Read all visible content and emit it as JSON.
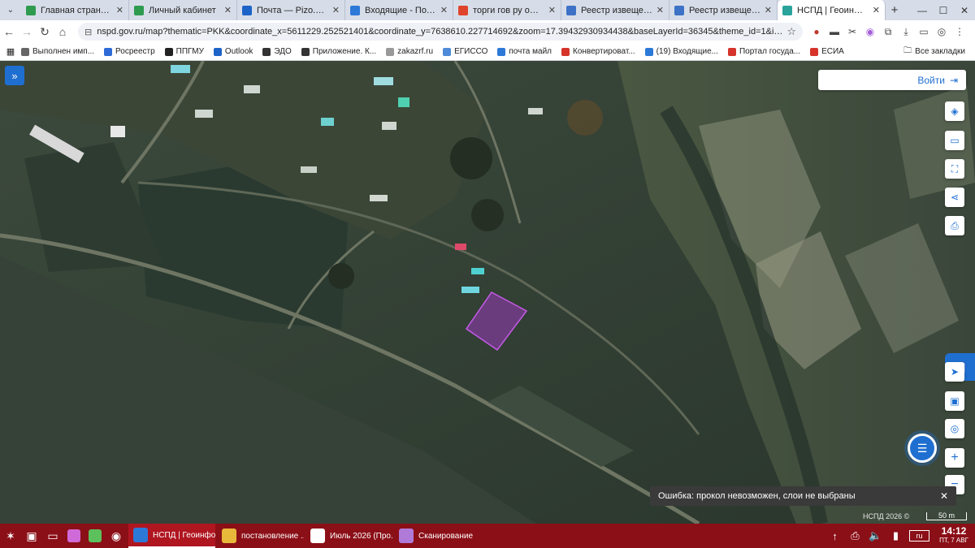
{
  "tabs": [
    {
      "title": "Главная страница",
      "color": "#2e9b4f",
      "active": false
    },
    {
      "title": "Личный кабинет",
      "color": "#2e9b4f",
      "active": false
    },
    {
      "title": "Почта — Pizo.Baltasi@",
      "color": "#1e64c8",
      "active": false
    },
    {
      "title": "Входящие - Почта M",
      "color": "#2c79d8",
      "active": false
    },
    {
      "title": "торги гов ру официа",
      "color": "#e0432b",
      "active": false
    },
    {
      "title": "Реестр извещений",
      "color": "#3d72c6",
      "active": false
    },
    {
      "title": "Реестр извещений",
      "color": "#3d72c6",
      "active": false
    },
    {
      "title": "НСПД | Геоинформа",
      "color": "#2aa39a",
      "active": true
    }
  ],
  "address": {
    "url": "nspd.gov.ru/map?thematic=PKK&coordinate_x=5611229.252521401&coordinate_y=7638610.227714692&zoom=17.39432930934438&baseLayerId=36345&theme_id=1&is_copy_url=true&sel..."
  },
  "bookmarks": [
    {
      "label": "Выполнен имп...",
      "color": "#666666"
    },
    {
      "label": "Росреестр",
      "color": "#2e6bd8"
    },
    {
      "label": "ППГМУ",
      "color": "#222222"
    },
    {
      "label": "Outlook",
      "color": "#1e64c8"
    },
    {
      "label": "ЭДО",
      "color": "#333333"
    },
    {
      "label": "Приложение. К...",
      "color": "#333333"
    },
    {
      "label": "zakazrf.ru",
      "color": "#999999"
    },
    {
      "label": "ЕГИССО",
      "color": "#4d8ad8"
    },
    {
      "label": "почта майл",
      "color": "#2c79d8"
    },
    {
      "label": "Конвертироват...",
      "color": "#d6342b"
    },
    {
      "label": "(19) Входящие...",
      "color": "#2c79d8"
    },
    {
      "label": "Портал госуда...",
      "color": "#d6342b"
    },
    {
      "label": "ЕСИА",
      "color": "#d6342b"
    }
  ],
  "bookmarks_all": "Все закладки",
  "map": {
    "login_label": "Войти",
    "error_message": "Ошибка: прокол невозможен, слои не выбраны",
    "copyright": "НСПД 2026 ©",
    "scale_label": "50 m",
    "highlight_color": "#b03ad8"
  },
  "taskbar": {
    "apps": [
      {
        "label": "НСПД | Геоинфо...",
        "color": "#2c79d8",
        "active": true
      },
      {
        "label": "постановление ...",
        "color": "#e8b83a",
        "active": false
      },
      {
        "label": "Июль 2026 (Про...",
        "color": "#ffffff",
        "active": false
      },
      {
        "label": "Сканирование",
        "color": "#b07ad8",
        "active": false
      }
    ],
    "lang": "ru",
    "time": "14:12",
    "date": "ПТ, 7 АВГ"
  }
}
